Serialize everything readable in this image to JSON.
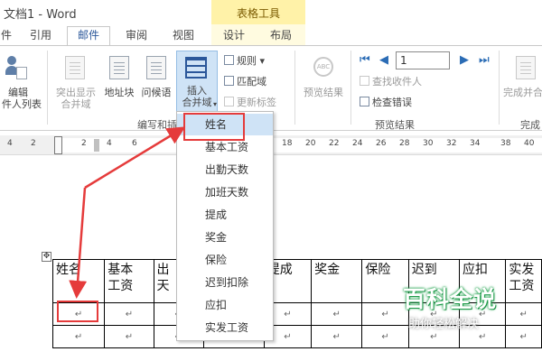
{
  "app": {
    "title": "文档1 - Word"
  },
  "context_tab_header": "表格工具",
  "tabs": [
    {
      "label": "件",
      "active": false
    },
    {
      "label": "引用",
      "active": false
    },
    {
      "label": "邮件",
      "active": true
    },
    {
      "label": "审阅",
      "active": false
    },
    {
      "label": "视图",
      "active": false
    },
    {
      "label": "设计",
      "active": false
    },
    {
      "label": "布局",
      "active": false
    }
  ],
  "ribbon": {
    "edit_recipients": {
      "line1": "编辑",
      "line2": "件人列表"
    },
    "highlight_fields": {
      "line1": "突出显示",
      "line2": "合并域"
    },
    "address_block": "地址块",
    "greeting_line": "问候语",
    "insert_merge_field": {
      "line1": "插入",
      "line2": "合并域"
    },
    "rules": "规则",
    "match_fields": "匹配域",
    "update_labels": "更新标签",
    "group_write_insert": "编写和插",
    "preview_results": "预览结果",
    "record_number": "1",
    "find_recipient": "查找收件人",
    "check_errors": "检查错误",
    "group_preview": "预览结果",
    "finish_merge": "完成并合",
    "group_finish": "完成"
  },
  "ruler": {
    "ticks": [
      "4",
      "2",
      "2",
      "4",
      "6",
      "18",
      "20",
      "22",
      "24",
      "26",
      "28",
      "30",
      "32",
      "34",
      "38",
      "40"
    ]
  },
  "merge_field_menu": {
    "items": [
      "姓名",
      "基本工资",
      "出勤天数",
      "加班天数",
      "提成",
      "奖金",
      "保险",
      "迟到扣除",
      "应扣",
      "实发工资"
    ]
  },
  "table": {
    "header": [
      "姓名",
      "基本\n工资",
      "出\n天",
      "",
      "提成",
      "奖金",
      "保险",
      "迟到",
      "应扣",
      "实发\n工资"
    ],
    "para_mark": "↵",
    "rows": 3
  },
  "watermark": {
    "title": "百科全说",
    "subtitle": "助你轻松解决"
  },
  "colors": {
    "accent": "#2b579a",
    "annotation_red": "#e53b3b",
    "context_tab": "#fff2a8",
    "menu_highlight": "#cfe3f6"
  }
}
